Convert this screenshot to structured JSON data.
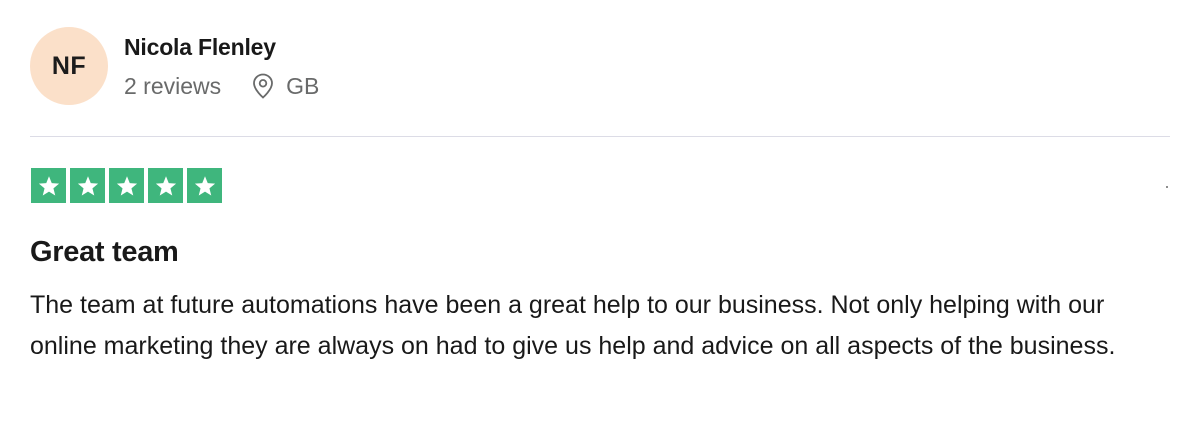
{
  "reviewer": {
    "initials": "NF",
    "avatar_color": "#fbe0c9",
    "name": "Nicola Flenley",
    "review_count": "2 reviews",
    "location_icon": "location-pin-icon",
    "country": "GB"
  },
  "rating": {
    "stars": 5,
    "max_stars": 5,
    "star_color": "#00b67a",
    "star_bg": "#3fb67d"
  },
  "review": {
    "title": "Great team",
    "body": "The team at future automations have been a great help to our business. Not only helping with our online marketing they are always on had to give us help and advice on all aspects of the business."
  }
}
